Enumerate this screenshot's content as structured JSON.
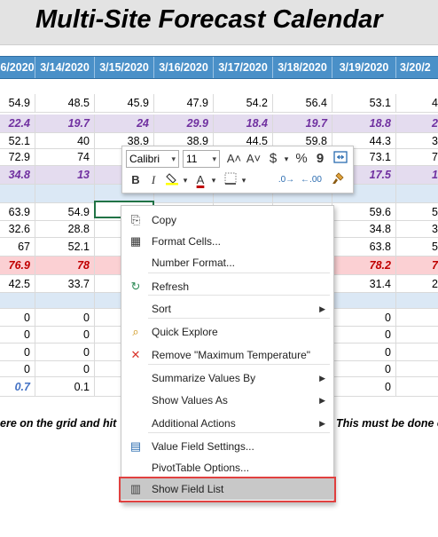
{
  "title": "Multi-Site Forecast Calendar",
  "dates": [
    "6/2020",
    "3/14/2020",
    "3/15/2020",
    "3/16/2020",
    "3/17/2020",
    "3/18/2020",
    "3/19/2020",
    "3/20/2"
  ],
  "rows": [
    {
      "style": "plain",
      "cells": [
        "54.9",
        "48.5",
        "45.9",
        "47.9",
        "54.2",
        "56.4",
        "53.1",
        "4"
      ]
    },
    {
      "style": "lav",
      "cells": [
        "22.4",
        "19.7",
        "24",
        "29.9",
        "18.4",
        "19.7",
        "18.8",
        "2"
      ]
    },
    {
      "style": "plain",
      "cells": [
        "52.1",
        "40",
        "38.9",
        "38.9",
        "44.5",
        "59.8",
        "44.3",
        "3"
      ]
    },
    {
      "style": "plain",
      "cells": [
        "72.9",
        "74",
        "",
        "",
        "",
        "",
        "73.1",
        "7"
      ]
    },
    {
      "style": "lav",
      "cells": [
        "34.8",
        "13",
        "",
        "",
        "",
        "",
        "17.5",
        "1"
      ]
    },
    {
      "style": "blue",
      "cells": [
        "",
        "",
        "",
        "",
        "",
        "",
        "",
        ""
      ]
    },
    {
      "style": "plain",
      "cells": [
        "63.9",
        "54.9",
        "",
        "",
        "",
        "",
        "59.6",
        "5"
      ]
    },
    {
      "style": "plain",
      "cells": [
        "32.6",
        "28.8",
        "",
        "",
        "",
        "",
        "34.8",
        "3"
      ]
    },
    {
      "style": "plain",
      "cells": [
        "67",
        "52.1",
        "",
        "",
        "",
        "",
        "63.8",
        "5"
      ]
    },
    {
      "style": "pink",
      "cells": [
        "76.9",
        "78",
        "",
        "",
        "",
        "",
        "78.2",
        "7"
      ]
    },
    {
      "style": "plain",
      "cells": [
        "42.5",
        "33.7",
        "",
        "",
        "",
        "",
        "31.4",
        "2"
      ]
    },
    {
      "style": "blue",
      "cells": [
        "",
        "",
        "",
        "",
        "",
        "",
        "",
        ""
      ]
    },
    {
      "style": "plain",
      "cells": [
        "0",
        "0",
        "",
        "",
        "",
        "",
        "0",
        ""
      ]
    },
    {
      "style": "plain",
      "cells": [
        "0",
        "0",
        "",
        "",
        "",
        "",
        "0",
        ""
      ]
    },
    {
      "style": "plain",
      "cells": [
        "0",
        "0",
        "",
        "",
        "",
        "",
        "0",
        ""
      ]
    },
    {
      "style": "plain",
      "cells": [
        "0",
        "0",
        "",
        "",
        "",
        "",
        "0",
        ""
      ]
    },
    {
      "style": "bluei",
      "cells": [
        "0.7",
        "0.1",
        "",
        "",
        "",
        "",
        "0",
        ""
      ]
    }
  ],
  "note_left": "ere on the grid and hit ",
  "note_right": "This must be done o",
  "mini_toolbar": {
    "font": "Calibri",
    "size": "11",
    "grow_font": "A˄",
    "shrink_font": "A˅",
    "currency": "$",
    "percent": "%",
    "comma": "9",
    "bold": "B",
    "italic": "I",
    "font_color_letter": "A",
    "font_color": "#c00000",
    "inc_decimal": ".0→",
    "dec_decimal": "←.00"
  },
  "menu": {
    "items": [
      {
        "label": "Copy",
        "icon": "copy-icon",
        "glyph": "⎘",
        "submenu": false
      },
      {
        "label": "Format Cells...",
        "icon": "format-cells-icon",
        "glyph": "▦",
        "submenu": false
      },
      {
        "label": "Number Format...",
        "icon": "",
        "glyph": "",
        "submenu": false
      },
      {
        "label": "Refresh",
        "icon": "refresh-icon",
        "glyph": "↻",
        "submenu": false
      },
      {
        "label": "Sort",
        "icon": "",
        "glyph": "",
        "submenu": true
      },
      {
        "label": "Quick Explore",
        "icon": "quick-explore-icon",
        "glyph": "⌕",
        "submenu": false
      },
      {
        "label": "Remove \"Maximum Temperature\"",
        "icon": "remove-icon",
        "glyph": "✕",
        "submenu": false
      },
      {
        "label": "Summarize Values By",
        "icon": "",
        "glyph": "",
        "submenu": true
      },
      {
        "label": "Show Values As",
        "icon": "",
        "glyph": "",
        "submenu": true
      },
      {
        "label": "Additional Actions",
        "icon": "",
        "glyph": "",
        "submenu": true
      },
      {
        "label": "Value Field Settings...",
        "icon": "value-field-settings-icon",
        "glyph": "▤",
        "submenu": false
      },
      {
        "label": "PivotTable Options...",
        "icon": "",
        "glyph": "",
        "submenu": false
      },
      {
        "label": "Show Field List",
        "icon": "field-list-icon",
        "glyph": "▥",
        "submenu": false
      }
    ],
    "highlighted": "Show Field List"
  },
  "colors": {
    "header_blue": "#4a90c8",
    "lavender_row": "#e4dcef",
    "blue_row": "#dbe8f5",
    "pink_row": "#fbd0d3",
    "highlight_outline": "#e0403f"
  }
}
